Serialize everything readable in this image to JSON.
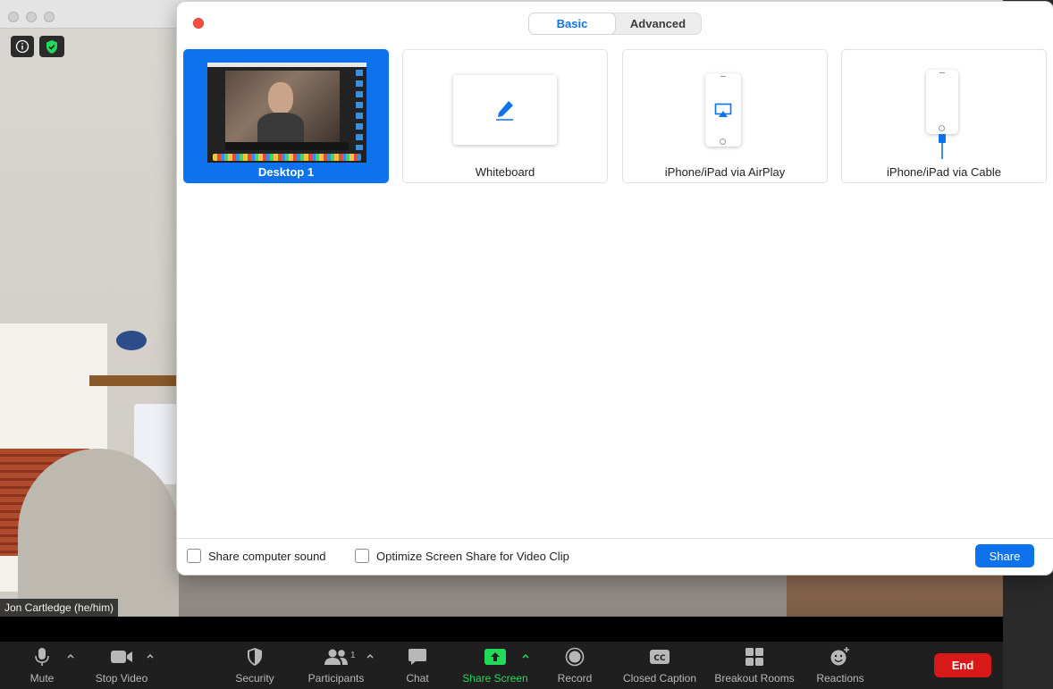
{
  "participant": {
    "name": "Jon Cartledge (he/him)"
  },
  "toolbar": {
    "mute": "Mute",
    "stop_video": "Stop Video",
    "security": "Security",
    "participants": "Participants",
    "participants_count": "1",
    "chat": "Chat",
    "share_screen": "Share Screen",
    "record": "Record",
    "closed_caption": "Closed Caption",
    "breakout_rooms": "Breakout Rooms",
    "reactions": "Reactions",
    "end": "End"
  },
  "dialog": {
    "tabs": [
      {
        "label": "Basic",
        "active": true
      },
      {
        "label": "Advanced",
        "active": false
      }
    ],
    "tiles": [
      {
        "label": "Desktop 1",
        "selected": true
      },
      {
        "label": "Whiteboard",
        "selected": false
      },
      {
        "label": "iPhone/iPad via AirPlay",
        "selected": false
      },
      {
        "label": "iPhone/iPad via Cable",
        "selected": false
      }
    ],
    "share_sound_label": "Share computer sound",
    "optimize_label": "Optimize Screen Share for Video Clip",
    "share_button": "Share"
  },
  "colors": {
    "accent": "#0e72ed",
    "end_red": "#d71919",
    "share_green": "#23d959",
    "security_green": "#23d959"
  },
  "icons": {
    "info": "info-icon",
    "security": "shield-check-icon",
    "whiteboard": "pen-icon",
    "airplay": "airplay-icon",
    "cable": "cable-icon"
  }
}
